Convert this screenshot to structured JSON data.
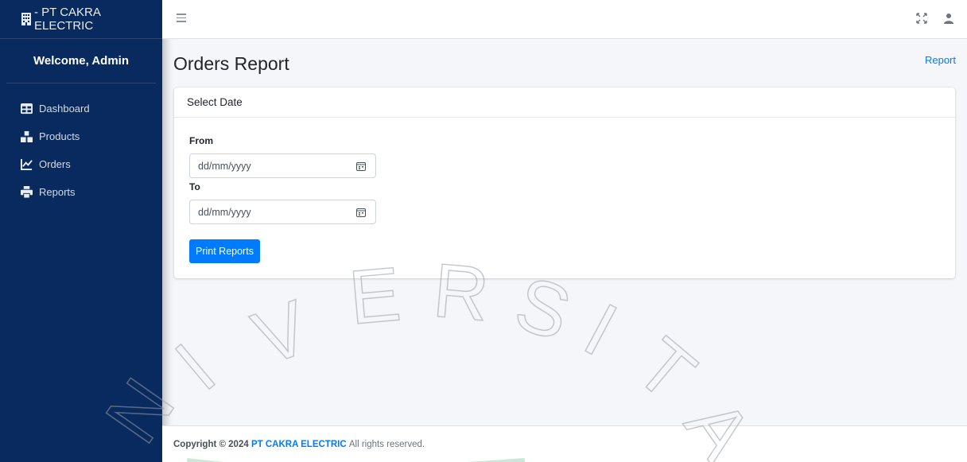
{
  "sidebar": {
    "brand_text": "- PT CAKRA ELECTRIC",
    "welcome": "Welcome, Admin",
    "items": [
      {
        "label": "Dashboard",
        "icon": "table-icon"
      },
      {
        "label": "Products",
        "icon": "boxes-icon"
      },
      {
        "label": "Orders",
        "icon": "chart-line-icon"
      },
      {
        "label": "Reports",
        "icon": "print-icon"
      }
    ]
  },
  "topbar": {
    "menu_icon": "hamburger-icon",
    "right_icons": [
      "expand-icon",
      "user-icon"
    ]
  },
  "header": {
    "title": "Orders Report",
    "breadcrumb": "Report"
  },
  "card": {
    "title": "Select Date",
    "from_label": "From",
    "from_placeholder": "dd/mm/yyyy",
    "to_label": "To",
    "to_placeholder": "dd/mm/yyyy",
    "button_label": "Print Reports"
  },
  "footer": {
    "prefix": "Copyright © 2024",
    "company": "PT CAKRA ELECTRIC",
    "suffix": "All rights reserved."
  },
  "watermark": {
    "letters": [
      "N",
      "I",
      "V",
      "E",
      "R",
      "S",
      "I",
      "T",
      "A"
    ]
  },
  "colors": {
    "sidebar_bg": "#082a5e",
    "accent": "#007bff",
    "content_bg": "#f4f6f9"
  }
}
